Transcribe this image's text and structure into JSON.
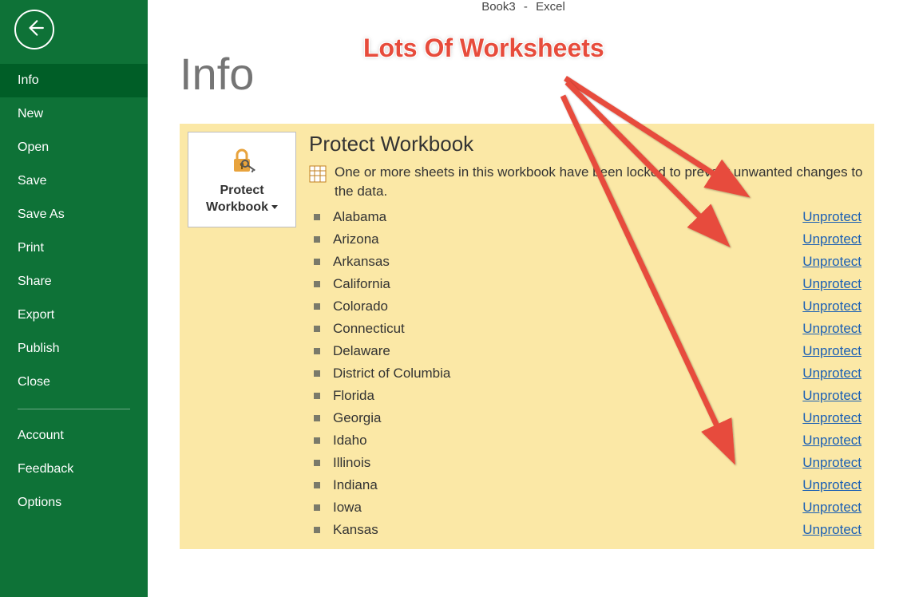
{
  "app": {
    "doc_title": "Book3",
    "dash": "-",
    "app_name": "Excel"
  },
  "sidebar": {
    "items": [
      {
        "label": "Info",
        "active": true
      },
      {
        "label": "New",
        "active": false
      },
      {
        "label": "Open",
        "active": false
      },
      {
        "label": "Save",
        "active": false
      },
      {
        "label": "Save As",
        "active": false
      },
      {
        "label": "Print",
        "active": false
      },
      {
        "label": "Share",
        "active": false
      },
      {
        "label": "Export",
        "active": false
      },
      {
        "label": "Publish",
        "active": false
      },
      {
        "label": "Close",
        "active": false
      }
    ],
    "footer_items": [
      {
        "label": "Account"
      },
      {
        "label": "Feedback"
      },
      {
        "label": "Options"
      }
    ]
  },
  "page": {
    "title": "Info"
  },
  "protect": {
    "button_line1": "Protect",
    "button_line2": "Workbook",
    "heading": "Protect Workbook",
    "description": "One or more sheets in this workbook have been locked to prevent unwanted changes to the data.",
    "unprotect_label": "Unprotect",
    "sheets": [
      "Alabama",
      "Arizona",
      "Arkansas",
      "California",
      "Colorado",
      "Connecticut",
      "Delaware",
      "District of Columbia",
      "Florida",
      "Georgia",
      "Idaho",
      "Illinois",
      "Indiana",
      "Iowa",
      "Kansas"
    ]
  },
  "annotation": {
    "text": "Lots Of Worksheets"
  },
  "colors": {
    "sidebar_bg": "#0e7237",
    "active_bg": "#005e27",
    "panel_bg": "#fbe8a6",
    "link": "#1a5fb4",
    "annot": "#e74c3c"
  }
}
